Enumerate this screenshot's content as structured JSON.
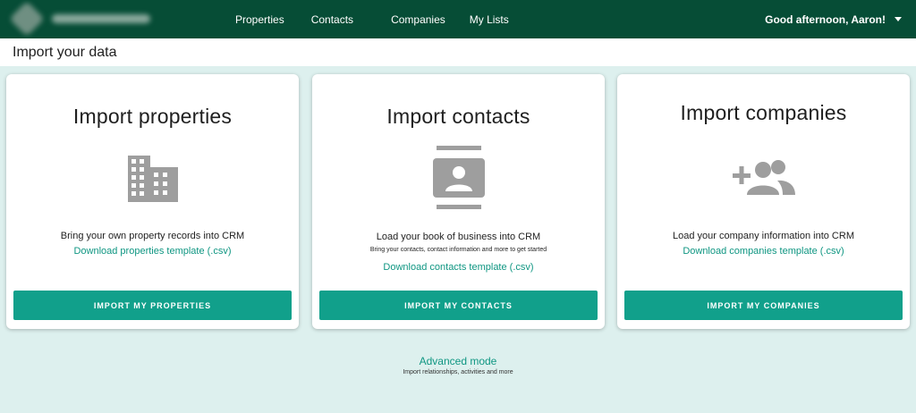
{
  "nav": {
    "items": [
      "Properties",
      "Contacts",
      "Companies",
      "My Lists"
    ],
    "greeting": "Good afternoon, Aaron!"
  },
  "page": {
    "title": "Import your data"
  },
  "cards": [
    {
      "title": "Import properties",
      "icon": "building-icon",
      "description": "Bring your own property records into CRM",
      "subtext": "",
      "download_label": "Download properties template (.csv)",
      "button_label": "IMPORT MY PROPERTIES"
    },
    {
      "title": "Import contacts",
      "icon": "contact-card-icon",
      "description": "Load your book of business into CRM",
      "subtext": "Bring your contacts, contact information and more to get started",
      "download_label": "Download contacts template (.csv)",
      "button_label": "IMPORT MY CONTACTS"
    },
    {
      "title": "Import companies",
      "icon": "group-add-icon",
      "description": "Load your company information into CRM",
      "subtext": "",
      "download_label": "Download companies template (.csv)",
      "button_label": "IMPORT MY COMPANIES"
    }
  ],
  "advanced": {
    "link": "Advanced mode",
    "note": "Import relationships, activities and more"
  },
  "colors": {
    "topbar": "#064d36",
    "accent": "#11a08b",
    "link": "#0f9682",
    "background": "#ddf0ee",
    "icon": "#9e9e9e"
  }
}
